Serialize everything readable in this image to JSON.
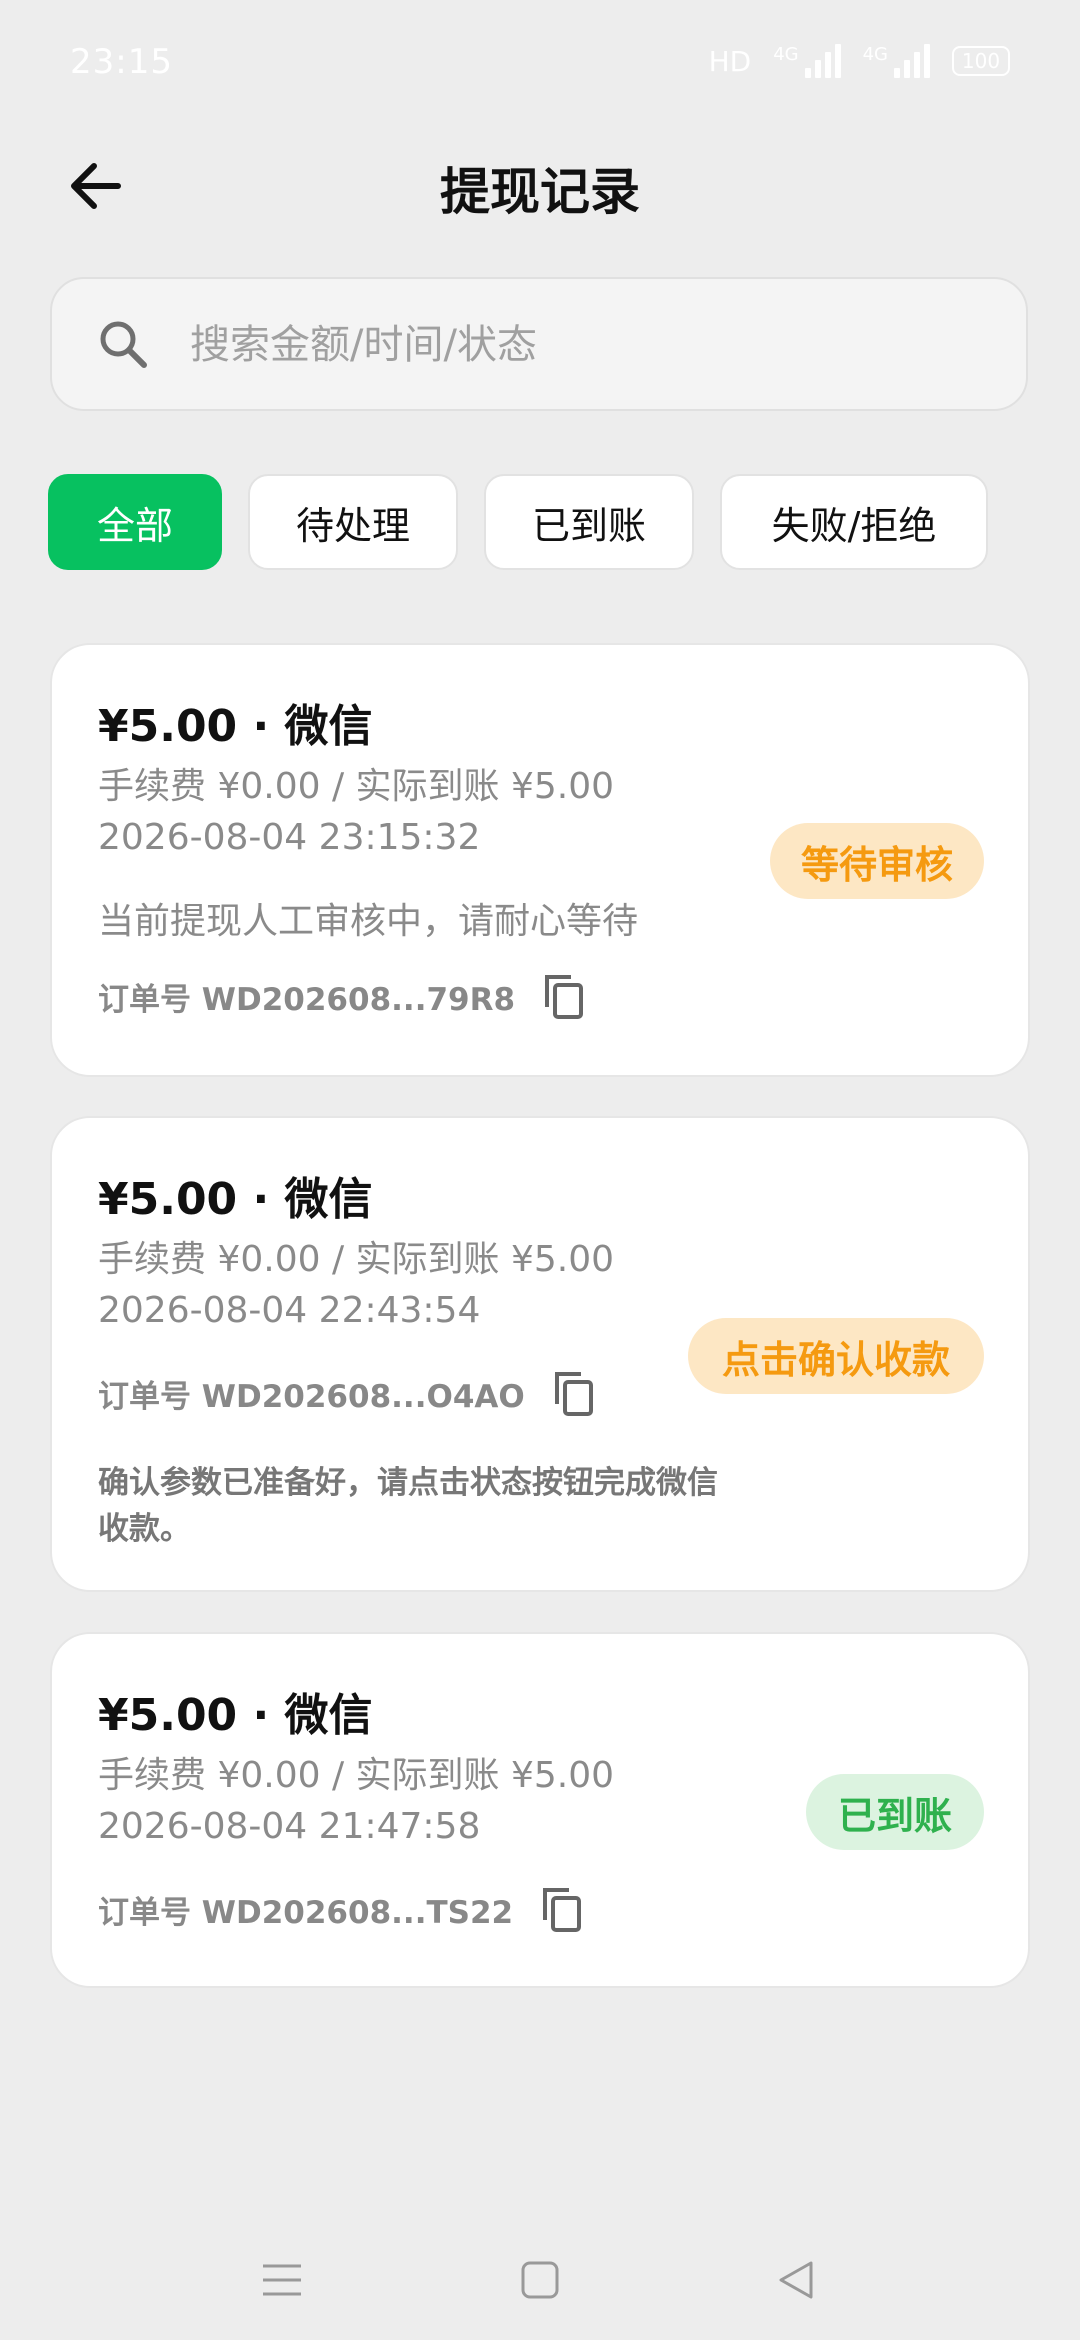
{
  "status_bar": {
    "time": "23:15",
    "hd": "HD",
    "net1": "4G",
    "net2": "4G",
    "battery": "100"
  },
  "header": {
    "title": "提现记录",
    "back_icon": "arrow-left-icon"
  },
  "search": {
    "placeholder": "搜索金额/时间/状态",
    "icon": "search-icon"
  },
  "filters": [
    "全部",
    "待处理",
    "已到账",
    "失败/拒绝"
  ],
  "active_filter": 0,
  "records": [
    {
      "title": "¥5.00 · 微信",
      "fee": "手续费 ¥0.00 / 实际到账 ¥5.00",
      "time": "2026-08-04 23:15:32",
      "note": "当前提现人工审核中，请耐心等待",
      "order": "订单号 WD202608...79R8",
      "status": "等待审核"
    },
    {
      "title": "¥5.00 · 微信",
      "fee": "手续费 ¥0.00 / 实际到账 ¥5.00",
      "time": "2026-08-04 22:43:54",
      "order": "订单号 WD202608...O4AO",
      "note": "确认参数已准备好，请点击状态按钮完成微信收款。",
      "status": "点击确认收款"
    },
    {
      "title": "¥5.00 · 微信",
      "fee": "手续费 ¥0.00 / 实际到账 ¥5.00",
      "time": "2026-08-04 21:47:58",
      "order": "订单号 WD202608...TS22",
      "status": "已到账"
    }
  ],
  "colors": {
    "accent": "#07c160",
    "pending_bg": "#fde7c4",
    "pending_text": "#f59a10",
    "success_bg": "#dcf3e0",
    "success_text": "#2fb14e"
  },
  "system_nav": [
    "menu-icon",
    "home-icon",
    "back-triangle-icon"
  ]
}
